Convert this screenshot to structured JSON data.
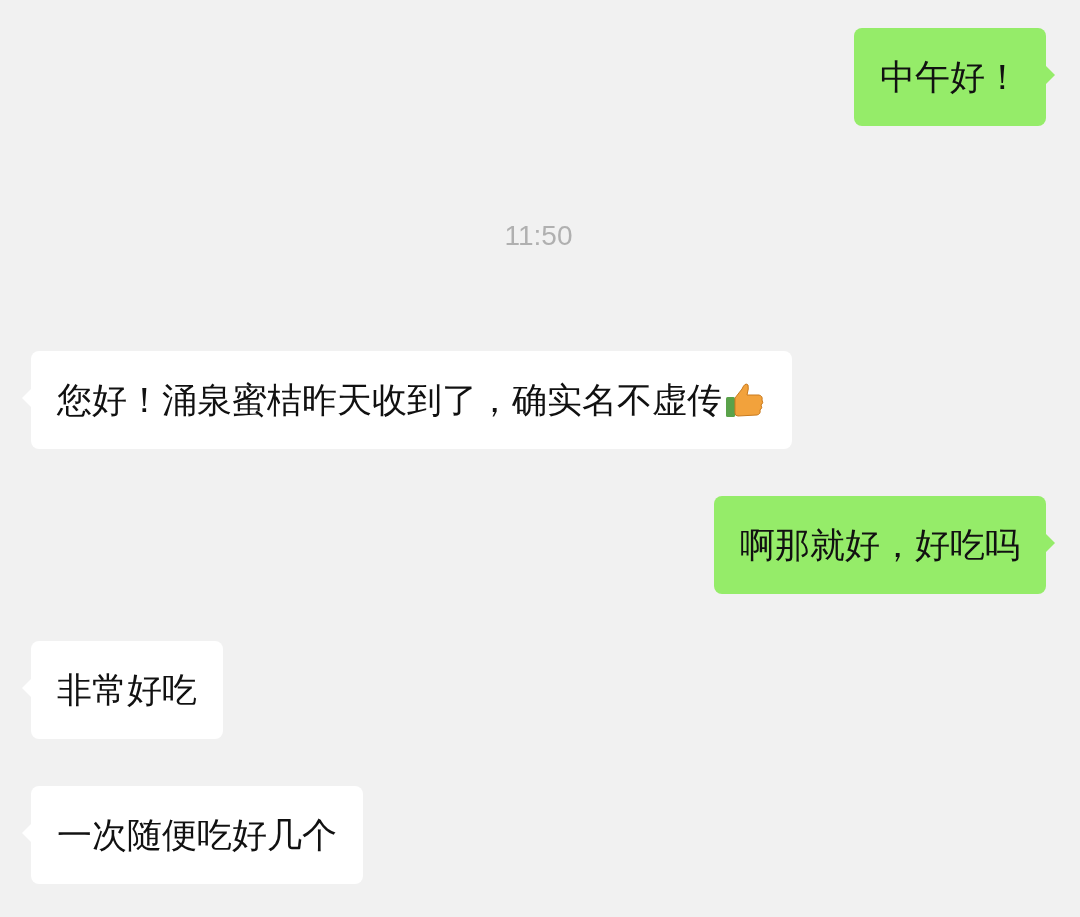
{
  "messages": [
    {
      "kind": "sent",
      "text": "中午好！",
      "thumbs_up": false
    },
    {
      "kind": "time",
      "text": "11:50"
    },
    {
      "kind": "received",
      "text": "您好！涌泉蜜桔昨天收到了，确实名不虚传",
      "thumbs_up": true
    },
    {
      "kind": "sent",
      "text": "啊那就好，好吃吗",
      "thumbs_up": false
    },
    {
      "kind": "received",
      "text": "非常好吃",
      "thumbs_up": false
    },
    {
      "kind": "received",
      "text": "一次随便吃好几个",
      "thumbs_up": false
    }
  ]
}
